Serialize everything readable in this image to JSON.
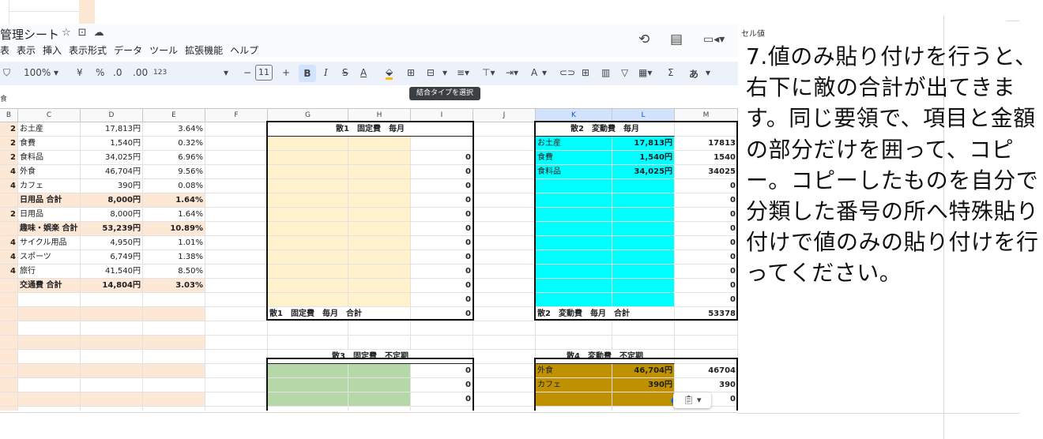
{
  "doc": {
    "title": "管理シート",
    "icons": [
      "star-icon",
      "move-icon",
      "cloud-icon"
    ],
    "menu": [
      "表",
      "表示",
      "挿入",
      "表示形式",
      "データ",
      "ツール",
      "拡張機能",
      "ヘルプ"
    ]
  },
  "toolbar": {
    "zoom": "100%",
    "currency": "¥",
    "percent": "%",
    "dec_dec": ".0",
    "dec_inc": ".00",
    "number_format": "123",
    "font_size": "11",
    "bold": "B",
    "italic": "I",
    "strike": "S",
    "text_color": "A",
    "font_color2": "A",
    "sum": "Σ",
    "input_tool": "あ",
    "tooltip": "結合タイプを選択"
  },
  "formula_bar": {
    "name_box": "食"
  },
  "columns": [
    "B",
    "C",
    "D",
    "E",
    "F",
    "G",
    "H",
    "I",
    "J",
    "K",
    "L",
    "M"
  ],
  "left_rows": [
    {
      "b": "2",
      "c": "お土産",
      "d": "17,813円",
      "e": "3.64%",
      "type": "item"
    },
    {
      "b": "2",
      "c": "食費",
      "d": "1,540円",
      "e": "0.32%",
      "type": "item"
    },
    {
      "b": "2",
      "c": "食料品",
      "d": "34,025円",
      "e": "6.96%",
      "type": "item"
    },
    {
      "b": "4",
      "c": "外食",
      "d": "46,704円",
      "e": "9.56%",
      "type": "item"
    },
    {
      "b": "4",
      "c": "カフェ",
      "d": "390円",
      "e": "0.08%",
      "type": "item"
    },
    {
      "b": "",
      "c": "日用品 合計",
      "d": "8,000円",
      "e": "1.64%",
      "type": "subtotal"
    },
    {
      "b": "2",
      "c": "日用品",
      "d": "8,000円",
      "e": "1.64%",
      "type": "item"
    },
    {
      "b": "",
      "c": "趣味・娯楽 合計",
      "d": "53,239円",
      "e": "10.89%",
      "type": "subtotal"
    },
    {
      "b": "4",
      "c": "サイクル用品",
      "d": "4,950円",
      "e": "1.01%",
      "type": "item"
    },
    {
      "b": "4",
      "c": "スポーツ",
      "d": "6,749円",
      "e": "1.38%",
      "type": "item"
    },
    {
      "b": "4",
      "c": "旅行",
      "d": "41,540円",
      "e": "8.50%",
      "type": "item"
    },
    {
      "b": "",
      "c": "交通費 合計",
      "d": "14,804円",
      "e": "3.03%",
      "type": "subtotal"
    }
  ],
  "box1": {
    "header": "散1　固定費　毎月",
    "values": [
      "",
      "0",
      "0",
      "0",
      "0",
      "0",
      "0",
      "0",
      "0",
      "0",
      "0",
      "0"
    ],
    "total_label": "散1　固定費　毎月　合計",
    "total_value": "0"
  },
  "box2": {
    "header": "散2　変動費　毎月",
    "items": [
      {
        "k": "お土産",
        "l": "17,813円",
        "m": "17813"
      },
      {
        "k": "食費",
        "l": "1,540円",
        "m": "1540"
      },
      {
        "k": "食料品",
        "l": "34,025円",
        "m": "34025"
      }
    ],
    "zeros": [
      "0",
      "0",
      "0",
      "0",
      "0",
      "0",
      "0",
      "0",
      "0"
    ],
    "total_label": "散2　変動費　毎月　合計",
    "total_value": "53378"
  },
  "box3": {
    "header": "散3　固定費　不定期",
    "values": [
      "0",
      "0",
      "0"
    ]
  },
  "box4": {
    "header": "散4　変動費　不定期",
    "items": [
      {
        "k": "外食",
        "l": "46,704円",
        "m": "46704"
      },
      {
        "k": "カフェ",
        "l": "390円",
        "m": "390"
      },
      {
        "k": "",
        "l": "",
        "m": "0"
      }
    ]
  },
  "side": {
    "cell_tag": "セル値",
    "instruction": "7.値のみ貼り付けを行うと、右下に敵の合計が出てきます。同じ要領で、項目と金額の部分だけを囲って、コピー。コピーしたものを自分で分類した番号の所へ特殊貼り付けで値のみの貼り付けを行ってください。"
  },
  "colors": {
    "yellow": "#fff2cc",
    "cyan": "#00ffff",
    "green": "#b6d7a8",
    "gold": "#bf9000",
    "peach": "#fde7d5",
    "toolbar_bg": "#edf2fa"
  }
}
